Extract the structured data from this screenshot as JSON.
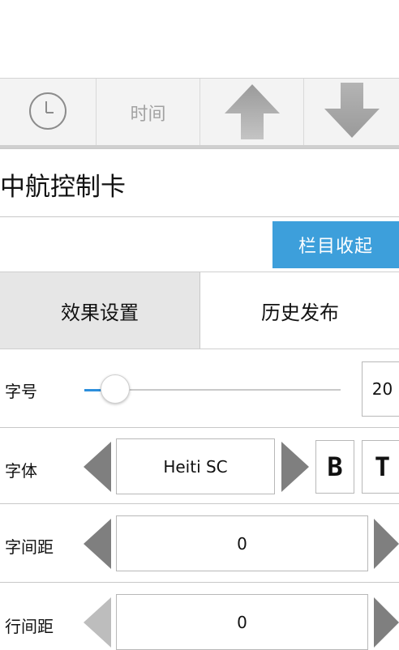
{
  "toolbar": {
    "time_label": "时间",
    "icons": [
      "clock-icon",
      "arrow-up-icon",
      "arrow-down-icon"
    ]
  },
  "card": {
    "title": "中航控制卡"
  },
  "collapse_button": {
    "label": "栏目收起",
    "color": "#3d9fdb"
  },
  "tabs": [
    {
      "label": "效果设置",
      "active": true
    },
    {
      "label": "历史发布",
      "active": false
    }
  ],
  "settings": {
    "font_size": {
      "label": "字号",
      "value": "20",
      "slider_fraction": 0.12
    },
    "font": {
      "label": "字体",
      "value": "Heiti SC",
      "bold_label": "B",
      "style_label": "T"
    },
    "letter_spacing": {
      "label": "字间距",
      "value": "0"
    },
    "line_spacing": {
      "label": "行间距",
      "value": "0"
    }
  }
}
